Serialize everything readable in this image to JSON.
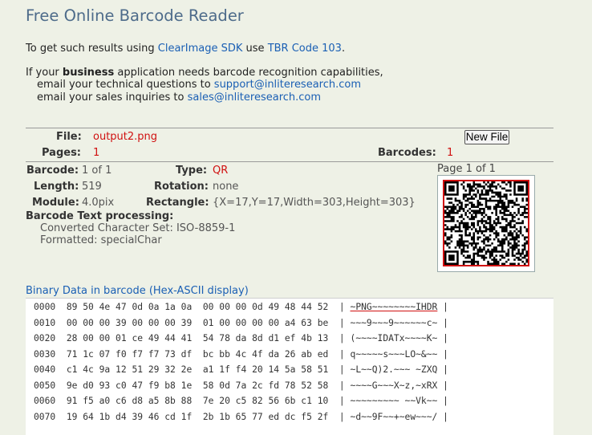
{
  "page": {
    "title": "Free Online Barcode Reader",
    "intro": {
      "prefix": "To get such results using ",
      "sdk_link": "ClearImage SDK",
      "middle": " use ",
      "tbr_link": "TBR Code 103",
      "suffix": "."
    },
    "business": {
      "line1_prefix": "If your ",
      "line1_bold": "business",
      "line1_suffix": " application needs barcode recognition capabilities,",
      "line2_prefix": "email your technical questions to ",
      "support_email": "support@inliteresearch.com",
      "line3_prefix": "email your sales inquiries to ",
      "sales_email": "sales@inliteresearch.com"
    }
  },
  "file_info": {
    "file_label": "File:",
    "file_value": "output2.png",
    "new_file_button": "New File",
    "pages_label": "Pages:",
    "pages_value": "1",
    "barcodes_label": "Barcodes:",
    "barcodes_value": "1"
  },
  "barcode": {
    "barcode_label": "Barcode:",
    "barcode_value": "1 of 1",
    "type_label": "Type:",
    "type_value": "QR",
    "length_label": "Length:",
    "length_value": "519",
    "rotation_label": "Rotation:",
    "rotation_value": "none",
    "module_label": "Module:",
    "module_value": "4.0pix",
    "rectangle_label": "Rectangle:",
    "rectangle_value": "{X=17,Y=17,Width=303,Height=303}",
    "processing_label": "Barcode Text processing:",
    "charset": "Converted Character Set: ISO-8859-1",
    "formatted": "Formatted: specialChar",
    "page_indicator": "Page 1 of 1"
  },
  "binary": {
    "title": "Binary Data in barcode (Hex-ASCII display)",
    "rows": [
      {
        "offset": "0000",
        "hex": "89 50 4e 47 0d 0a 1a 0a  00 00 00 0d 49 48 44 52",
        "ascii": "~PNG~~~~~~~~IHDR"
      },
      {
        "offset": "0010",
        "hex": "00 00 00 39 00 00 00 39  01 00 00 00 00 a4 63 be",
        "ascii": "~~~9~~~9~~~~~~c~"
      },
      {
        "offset": "0020",
        "hex": "28 00 00 01 ce 49 44 41  54 78 da 8d d1 ef 4b 13",
        "ascii": "(~~~~IDATx~~~~K~"
      },
      {
        "offset": "0030",
        "hex": "71 1c 07 f0 f7 f7 73 df  bc bb 4c 4f da 26 ab ed",
        "ascii": "q~~~~~s~~~LO~&~~"
      },
      {
        "offset": "0040",
        "hex": "c1 4c 9a 12 51 29 32 2e  a1 1f f4 20 14 5a 58 51",
        "ascii": "~L~~Q)2.~~~ ~ZXQ"
      },
      {
        "offset": "0050",
        "hex": "9e d0 93 c0 47 f9 b8 1e  58 0d 7a 2c fd 78 52 58",
        "ascii": "~~~~G~~~X~z,~xRX"
      },
      {
        "offset": "0060",
        "hex": "91 f5 a0 c6 d8 a5 8b 88  7e 20 c5 82 56 6b c1 10",
        "ascii": "~~~~~~~~~ ~~Vk~~"
      },
      {
        "offset": "0070",
        "hex": "19 64 1b d4 39 46 cd 1f  2b 1b 65 77 ed dc f5 2f",
        "ascii": "~d~~9F~~+~ew~~~/"
      }
    ]
  }
}
